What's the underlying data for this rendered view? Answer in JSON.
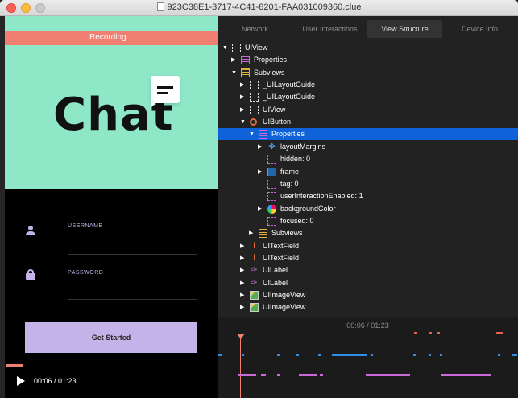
{
  "window": {
    "title": "923C38E1-3717-4C41-8201-FAA031009360.clue"
  },
  "preview": {
    "recording_label": "Recording...",
    "hero_title": "Chat",
    "username_label": "USERNAME",
    "password_label": "PASSWORD",
    "button_label": "Get Started",
    "time": "00:06 / 01:23",
    "colors": {
      "mint": "#8ee8c8",
      "recording": "#f07f72",
      "accent": "#c4b3e8"
    }
  },
  "tabs": [
    {
      "label": "Network",
      "active": false
    },
    {
      "label": "User Interactions",
      "active": false
    },
    {
      "label": "View Structure",
      "active": true
    },
    {
      "label": "Device Info",
      "active": false
    }
  ],
  "tree": [
    {
      "label": "UIView",
      "depth": 0,
      "disclosure": "open",
      "icon": "dashed"
    },
    {
      "label": "Properties",
      "depth": 1,
      "disclosure": "closed",
      "icon": "yellow-pink"
    },
    {
      "label": "Subviews",
      "depth": 1,
      "disclosure": "open",
      "icon": "yellow"
    },
    {
      "label": "_UILayoutGuide",
      "depth": 2,
      "disclosure": "closed",
      "icon": "dashed"
    },
    {
      "label": "_UILayoutGuide",
      "depth": 2,
      "disclosure": "closed",
      "icon": "dashed"
    },
    {
      "label": "UIView",
      "depth": 2,
      "disclosure": "closed",
      "icon": "dashed"
    },
    {
      "label": "UIButton",
      "depth": 2,
      "disclosure": "open",
      "icon": "orange-circle"
    },
    {
      "label": "Properties",
      "depth": 3,
      "disclosure": "open",
      "icon": "yellow-pink",
      "selected": true
    },
    {
      "label": "layoutMargins",
      "depth": 4,
      "disclosure": "closed",
      "icon": "blue-cross"
    },
    {
      "label": "hidden: 0",
      "depth": 4,
      "disclosure": "none",
      "icon": "dashed-pink"
    },
    {
      "label": "frame",
      "depth": 4,
      "disclosure": "closed",
      "icon": "blue-box"
    },
    {
      "label": "tag: 0",
      "depth": 4,
      "disclosure": "none",
      "icon": "dashed-pink"
    },
    {
      "label": "userInteractionEnabled: 1",
      "depth": 4,
      "disclosure": "none",
      "icon": "dashed-pink"
    },
    {
      "label": "backgroundColor",
      "depth": 4,
      "disclosure": "closed",
      "icon": "rainbow"
    },
    {
      "label": "focused: 0",
      "depth": 4,
      "disclosure": "none",
      "icon": "dashed-pink"
    },
    {
      "label": "Subviews",
      "depth": 3,
      "disclosure": "closed",
      "icon": "yellow"
    },
    {
      "label": "UITextField",
      "depth": 2,
      "disclosure": "closed",
      "icon": "text-cursor"
    },
    {
      "label": "UITextField",
      "depth": 2,
      "disclosure": "closed",
      "icon": "text-cursor"
    },
    {
      "label": "UILabel",
      "depth": 2,
      "disclosure": "closed",
      "icon": "tag"
    },
    {
      "label": "UILabel",
      "depth": 2,
      "disclosure": "closed",
      "icon": "tag"
    },
    {
      "label": "UIImageView",
      "depth": 2,
      "disclosure": "closed",
      "icon": "image"
    },
    {
      "label": "UIImageView",
      "depth": 2,
      "disclosure": "closed",
      "icon": "image"
    }
  ],
  "timeline": {
    "time": "00:06 / 01:23",
    "colors": {
      "red": "#e8604e",
      "blue": "#2f8ee8",
      "pink": "#c96ad8"
    }
  }
}
